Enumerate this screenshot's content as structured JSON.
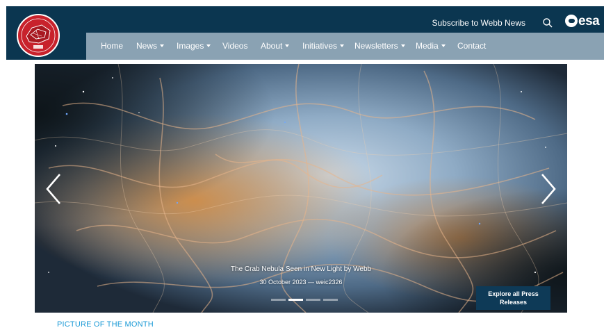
{
  "header": {
    "logo_icon": "webb-mission-logo",
    "logo_text": "NASA | ESA | CSA",
    "subscribe_label": "Subscribe to Webb News",
    "search_icon": "search-icon",
    "esa_label": "esa",
    "colors": {
      "topbar": "#0b3650",
      "navbar": "#8aa2b3",
      "logo": "#c8222c"
    }
  },
  "nav": {
    "items": [
      {
        "label": "Home",
        "dropdown": false
      },
      {
        "label": "News",
        "dropdown": true
      },
      {
        "label": "Images",
        "dropdown": true
      },
      {
        "label": "Videos",
        "dropdown": false
      },
      {
        "label": "About",
        "dropdown": true
      },
      {
        "label": "Initiatives",
        "dropdown": true
      },
      {
        "label": "Newsletters",
        "dropdown": true
      },
      {
        "label": "Media",
        "dropdown": true
      },
      {
        "label": "Contact",
        "dropdown": false
      }
    ]
  },
  "carousel": {
    "title": "The Crab Nebula Seen in New Light by Webb",
    "meta": "30 October 2023 — weic2326",
    "explore_label": "Explore all Press Releases",
    "slide_count": 4,
    "active_slide": 2,
    "prev_icon": "chevron-left-icon",
    "next_icon": "chevron-right-icon"
  },
  "section": {
    "heading": "PICTURE OF THE MONTH",
    "color": "#1a9ad6"
  }
}
